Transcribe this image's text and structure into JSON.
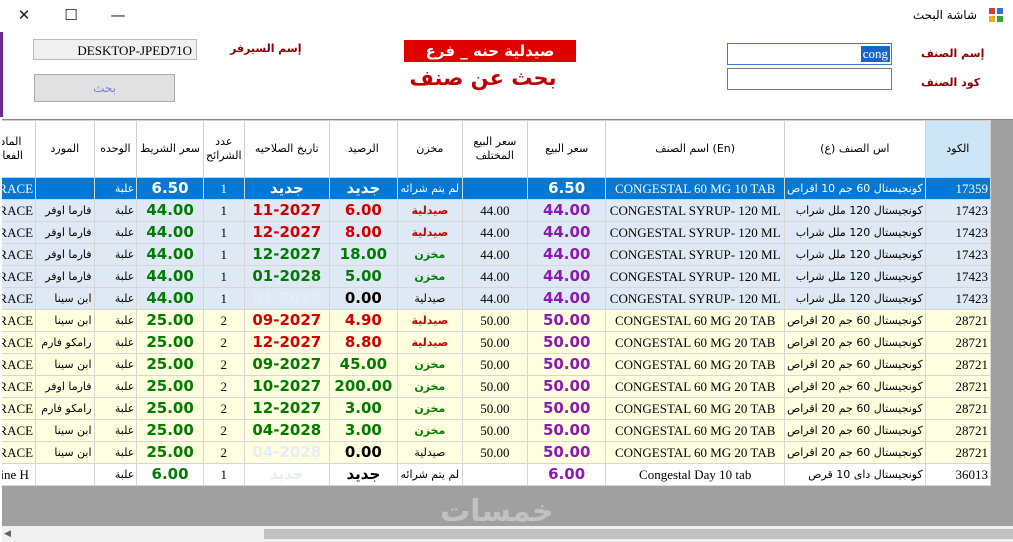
{
  "window": {
    "title": "شاشة البحث",
    "close": "✕",
    "maximize": "☐",
    "minimize": "—"
  },
  "form": {
    "server_label": "إسم السيرفر",
    "server_value": "DESKTOP-JPED71O",
    "search_button": "بحث",
    "pharmacy_title": "صيدلية حنه _ فرع الثانوية",
    "subtitle": "بحث عن صنف",
    "item_name_label": "إسم الصنف",
    "item_name_value": "cong",
    "item_code_label": "كود الصنف",
    "item_code_value": ""
  },
  "columns": [
    "الكود",
    "اس الصنف (ع)",
    "اسم الصنف (En)",
    "سعر البيع",
    "سعر البيع المختلف",
    "مخزن",
    "الرصيد",
    "تاريخ الصلاحيه",
    "عدد الشرائح",
    "سعر الشريط",
    "الوحده",
    "المورد",
    "المادة الفعالة"
  ],
  "colors": {
    "selected_row": "#0078d7",
    "row_blue": "#dfe9f6",
    "row_yellow": "#ffffe0",
    "purple": "#8b1ab0",
    "green": "#007a00",
    "red": "#d00000",
    "title_red": "#e00000"
  },
  "rows": [
    {
      "code": "17359",
      "name_ar": "كونجيستال 60 جم 10 اقراص",
      "name_en": "CONGESTAL 60 MG  10 TAB",
      "price": "6.50",
      "diff_price": "",
      "store": "لم يتم شرائه",
      "balance": "جديد",
      "expiry": "جديد",
      "strips": "1",
      "strip_price": "6.50",
      "unit": "علبة",
      "supplier": "",
      "active": "PARACE",
      "bg": "selected",
      "store_style": "white",
      "balance_style": "white",
      "expiry_style": "white"
    },
    {
      "code": "17423",
      "name_ar": "كونجيستال 120 ملل شراب",
      "name_en": "CONGESTAL SYRUP- 120 ML",
      "price": "44.00",
      "diff_price": "44.00",
      "store": "صيدلية",
      "balance": "6.00",
      "expiry": "11-2027",
      "strips": "1",
      "strip_price": "44.00",
      "unit": "علبة",
      "supplier": "فارما اوفر",
      "active": "PARACE",
      "bg": "blue",
      "store_style": "red",
      "balance_style": "red",
      "expiry_style": "red"
    },
    {
      "code": "17423",
      "name_ar": "كونجيستال 120 ملل شراب",
      "name_en": "CONGESTAL SYRUP- 120 ML",
      "price": "44.00",
      "diff_price": "44.00",
      "store": "صيدلية",
      "balance": "8.00",
      "expiry": "12-2027",
      "strips": "1",
      "strip_price": "44.00",
      "unit": "علبة",
      "supplier": "فارما اوفر",
      "active": "PARACE",
      "bg": "blue",
      "store_style": "red",
      "balance_style": "red",
      "expiry_style": "red"
    },
    {
      "code": "17423",
      "name_ar": "كونجيستال 120 ملل شراب",
      "name_en": "CONGESTAL SYRUP- 120 ML",
      "price": "44.00",
      "diff_price": "44.00",
      "store": "مخزن",
      "balance": "18.00",
      "expiry": "12-2027",
      "strips": "1",
      "strip_price": "44.00",
      "unit": "علبة",
      "supplier": "فارما اوفر",
      "active": "PARACE",
      "bg": "blue",
      "store_style": "green",
      "balance_style": "green",
      "expiry_style": "green"
    },
    {
      "code": "17423",
      "name_ar": "كونجيستال 120 ملل شراب",
      "name_en": "CONGESTAL SYRUP- 120 ML",
      "price": "44.00",
      "diff_price": "44.00",
      "store": "مخزن",
      "balance": "5.00",
      "expiry": "01-2028",
      "strips": "1",
      "strip_price": "44.00",
      "unit": "علبة",
      "supplier": "فارما اوفر",
      "active": "PARACE",
      "bg": "blue",
      "store_style": "green",
      "balance_style": "green",
      "expiry_style": "green"
    },
    {
      "code": "17423",
      "name_ar": "كونجيستال 120 ملل شراب",
      "name_en": "CONGESTAL SYRUP- 120 ML",
      "price": "44.00",
      "diff_price": "44.00",
      "store": "صيدلية",
      "balance": "0.00",
      "expiry": "01-2028",
      "strips": "1",
      "strip_price": "44.00",
      "unit": "علبة",
      "supplier": "ابن سينا",
      "active": "PARACE",
      "bg": "blue",
      "store_style": "black",
      "balance_style": "black",
      "expiry_style": "faint"
    },
    {
      "code": "28721",
      "name_ar": "كونجيستال 60 جم 20 اقراص",
      "name_en": "CONGESTAL 60 MG  20 TAB",
      "price": "50.00",
      "diff_price": "50.00",
      "store": "صيدلية",
      "balance": "4.90",
      "expiry": "09-2027",
      "strips": "2",
      "strip_price": "25.00",
      "unit": "علبة",
      "supplier": "ابن سينا",
      "active": "PARACE",
      "bg": "yellow",
      "store_style": "red",
      "balance_style": "red",
      "expiry_style": "red"
    },
    {
      "code": "28721",
      "name_ar": "كونجيستال 60 جم 20 اقراص",
      "name_en": "CONGESTAL 60 MG  20 TAB",
      "price": "50.00",
      "diff_price": "50.00",
      "store": "صيدلية",
      "balance": "8.80",
      "expiry": "12-2027",
      "strips": "2",
      "strip_price": "25.00",
      "unit": "علبة",
      "supplier": "رامكو فارم",
      "active": "PARACE",
      "bg": "yellow",
      "store_style": "red",
      "balance_style": "red",
      "expiry_style": "red"
    },
    {
      "code": "28721",
      "name_ar": "كونجيستال 60 جم 20 اقراص",
      "name_en": "CONGESTAL 60 MG  20 TAB",
      "price": "50.00",
      "diff_price": "50.00",
      "store": "مخزن",
      "balance": "45.00",
      "expiry": "09-2027",
      "strips": "2",
      "strip_price": "25.00",
      "unit": "علبة",
      "supplier": "ابن سينا",
      "active": "PARACE",
      "bg": "yellow",
      "store_style": "green",
      "balance_style": "green",
      "expiry_style": "green"
    },
    {
      "code": "28721",
      "name_ar": "كونجيستال 60 جم 20 اقراص",
      "name_en": "CONGESTAL 60 MG  20 TAB",
      "price": "50.00",
      "diff_price": "50.00",
      "store": "مخزن",
      "balance": "200.00",
      "expiry": "10-2027",
      "strips": "2",
      "strip_price": "25.00",
      "unit": "علبة",
      "supplier": "فارما اوفر",
      "active": "PARACE",
      "bg": "yellow",
      "store_style": "green",
      "balance_style": "green",
      "expiry_style": "green"
    },
    {
      "code": "28721",
      "name_ar": "كونجيستال 60 جم 20 اقراص",
      "name_en": "CONGESTAL 60 MG  20 TAB",
      "price": "50.00",
      "diff_price": "50.00",
      "store": "مخزن",
      "balance": "3.00",
      "expiry": "12-2027",
      "strips": "2",
      "strip_price": "25.00",
      "unit": "علبة",
      "supplier": "رامكو فارم",
      "active": "PARACE",
      "bg": "yellow",
      "store_style": "green",
      "balance_style": "green",
      "expiry_style": "green"
    },
    {
      "code": "28721",
      "name_ar": "كونجيستال 60 جم 20 اقراص",
      "name_en": "CONGESTAL 60 MG  20 TAB",
      "price": "50.00",
      "diff_price": "50.00",
      "store": "مخزن",
      "balance": "3.00",
      "expiry": "04-2028",
      "strips": "2",
      "strip_price": "25.00",
      "unit": "علبة",
      "supplier": "ابن سينا",
      "active": "PARACE",
      "bg": "yellow",
      "store_style": "green",
      "balance_style": "green",
      "expiry_style": "green"
    },
    {
      "code": "28721",
      "name_ar": "كونجيستال 60 جم 20 اقراص",
      "name_en": "CONGESTAL 60 MG  20 TAB",
      "price": "50.00",
      "diff_price": "50.00",
      "store": "صيدلية",
      "balance": "0.00",
      "expiry": "04-2028",
      "strips": "2",
      "strip_price": "25.00",
      "unit": "علبة",
      "supplier": "ابن سينا",
      "active": "PARACE",
      "bg": "yellow",
      "store_style": "black",
      "balance_style": "black",
      "expiry_style": "faint"
    },
    {
      "code": "36013",
      "name_ar": "كونجيستال داى 10 قرص",
      "name_en": "Congestal Day 10 tab",
      "price": "6.00",
      "diff_price": "",
      "store": "لم يتم شرائه",
      "balance": "جديد",
      "expiry": "جديد",
      "strips": "1",
      "strip_price": "6.00",
      "unit": "علبة",
      "supplier": "",
      "active": "phrine H",
      "bg": "white",
      "store_style": "black",
      "balance_style": "black",
      "expiry_style": "faint"
    }
  ]
}
